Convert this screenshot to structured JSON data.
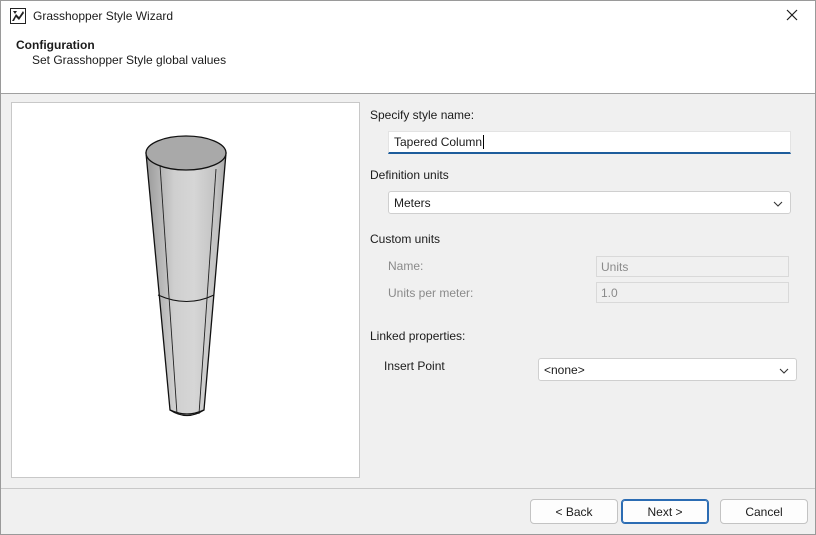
{
  "window": {
    "title": "Grasshopper Style Wizard",
    "icons": {
      "app": "grasshopper-icon",
      "close": "close-icon"
    }
  },
  "header": {
    "title": "Configuration",
    "subtitle": "Set Grasshopper Style global values"
  },
  "form": {
    "style_name_label": "Specify style name:",
    "style_name_value": "Tapered Column",
    "definition_units_label": "Definition units",
    "definition_units_value": "Meters",
    "custom_units_label": "Custom units",
    "name_label": "Name:",
    "name_value": "Units",
    "units_per_meter_label": "Units per meter:",
    "units_per_meter_value": "1.0",
    "linked_properties_label": "Linked properties:",
    "insert_point_label": "Insert Point",
    "insert_point_value": "<none>"
  },
  "footer": {
    "back_label": "< Back",
    "next_label": "Next >",
    "cancel_label": "Cancel"
  },
  "colors": {
    "accent": "#1d5d9c",
    "primary_button_border": "#2b6cb3"
  }
}
